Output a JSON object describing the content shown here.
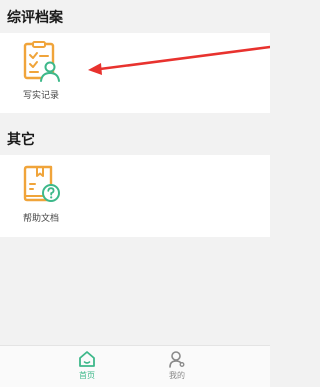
{
  "sections": [
    {
      "title": "综评档案",
      "tiles": [
        {
          "label": "写实记录",
          "icon": "record-document-person-icon"
        }
      ]
    },
    {
      "title": "其它",
      "tiles": [
        {
          "label": "帮助文档",
          "icon": "help-book-question-icon"
        }
      ]
    }
  ],
  "annotation": {
    "type": "red-arrow",
    "color": "#e8322e"
  },
  "tabbar": {
    "active_color": "#3db88a",
    "inactive_color": "#8a8a8a",
    "tabs": [
      {
        "label": "首页",
        "icon": "home-icon",
        "active": true
      },
      {
        "label": "我的",
        "icon": "user-icon",
        "active": false
      }
    ]
  },
  "colors": {
    "icon_orange": "#f0a43a",
    "icon_green": "#3db88a",
    "background": "#f2f2f2"
  }
}
